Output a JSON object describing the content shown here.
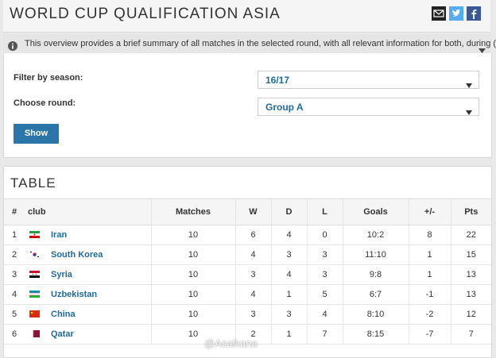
{
  "header": {
    "title": "WORLD CUP QUALIFICATION ASIA",
    "share_icons": [
      "email-icon",
      "twitter-icon",
      "facebook-icon"
    ]
  },
  "info": {
    "text": "This overview provides a brief summary of all matches in the selected round, with all relevant information for both, during (live)..."
  },
  "filters": {
    "season_label": "Filter by season:",
    "season_value": "16/17",
    "round_label": "Choose round:",
    "round_value": "Group A",
    "show_label": "Show"
  },
  "table": {
    "title": "TABLE",
    "headers": {
      "pos": "#",
      "club": "club",
      "matches": "Matches",
      "w": "W",
      "d": "D",
      "l": "L",
      "goals": "Goals",
      "diff": "+/-",
      "pts": "Pts"
    },
    "rows": [
      {
        "pos": "1",
        "club": "Iran",
        "flag": "iran",
        "matches": "10",
        "w": "6",
        "d": "4",
        "l": "0",
        "goals": "10:2",
        "diff": "8",
        "pts": "22"
      },
      {
        "pos": "2",
        "club": "South Korea",
        "flag": "korea",
        "matches": "10",
        "w": "4",
        "d": "3",
        "l": "3",
        "goals": "11:10",
        "diff": "1",
        "pts": "15"
      },
      {
        "pos": "3",
        "club": "Syria",
        "flag": "syria",
        "matches": "10",
        "w": "3",
        "d": "4",
        "l": "3",
        "goals": "9:8",
        "diff": "1",
        "pts": "13"
      },
      {
        "pos": "4",
        "club": "Uzbekistan",
        "flag": "uzbekistan",
        "matches": "10",
        "w": "4",
        "d": "1",
        "l": "5",
        "goals": "6:7",
        "diff": "-1",
        "pts": "13"
      },
      {
        "pos": "5",
        "club": "China",
        "flag": "china",
        "matches": "10",
        "w": "3",
        "d": "3",
        "l": "4",
        "goals": "8:10",
        "diff": "-2",
        "pts": "12"
      },
      {
        "pos": "6",
        "club": "Qatar",
        "flag": "qatar",
        "matches": "10",
        "w": "2",
        "d": "1",
        "l": "7",
        "goals": "8:15",
        "diff": "-7",
        "pts": "7"
      }
    ]
  },
  "watermark": "@Asaikana",
  "colors": {
    "accent": "#2a76a8",
    "link": "#1f6b9a",
    "twitter": "#55acee",
    "facebook": "#3b5998"
  }
}
